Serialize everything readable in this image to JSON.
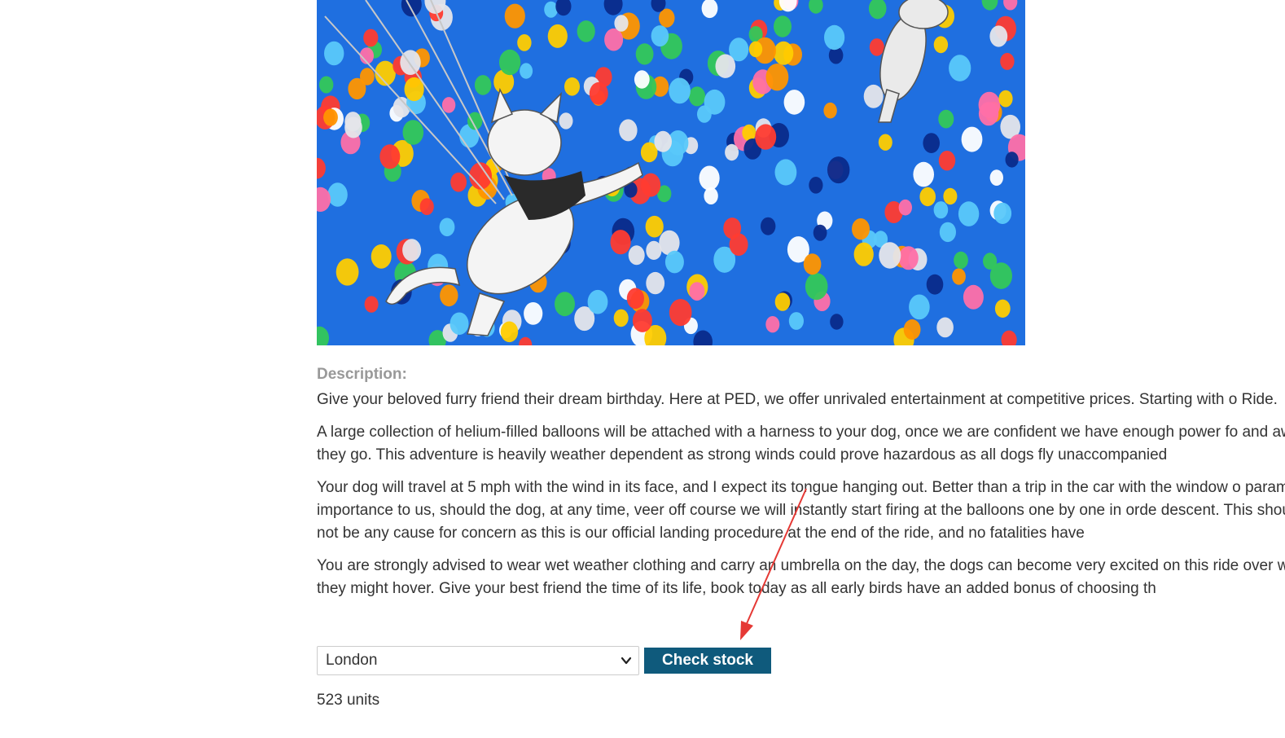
{
  "product": {
    "image_alt": "dog lifted by balloons",
    "description_label": "Description:",
    "paragraphs": [
      "Give your beloved furry friend their dream birthday. Here at PED, we offer unrivaled entertainment at competitive prices. Starting with o Ride.",
      "A large collection of helium-filled balloons will be attached with a harness to your dog, once we are confident we have enough power fo and away they go. This adventure is heavily weather dependent as strong winds could prove hazardous as all dogs fly unaccompanied",
      "Your dog will travel at 5 mph with the wind in its face, and I expect its tongue hanging out. Better than a trip in the car with the window o paramount importance to us, should the dog, at any time, veer off course we will instantly start firing at the balloons one by one in orde descent. This should not be any cause for concern as this is our official landing procedure at the end of the ride, and no fatalities have",
      "You are strongly advised to wear wet weather clothing and carry an umbrella on the day, the dogs can become very excited on this ride over where they might hover. Give your best friend the time of its life, book today as all early birds have an added bonus of choosing th"
    ]
  },
  "stock_check": {
    "selected_store": "London",
    "button_label": "Check stock",
    "result": "523 units"
  },
  "colors": {
    "button_bg": "#0f5a7c",
    "label_gray": "#999999",
    "annotation_arrow": "#e53935"
  },
  "icons": {
    "select_caret": "chevron-down-icon",
    "annotation": "red-arrow-annotation"
  }
}
